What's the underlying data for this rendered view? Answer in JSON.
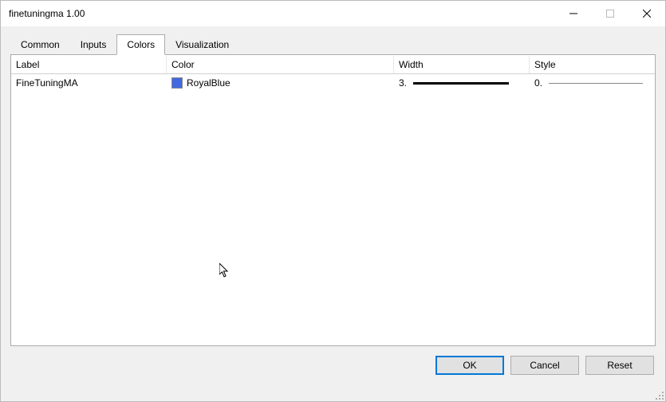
{
  "window": {
    "title": "finetuningma 1.00"
  },
  "tabs": {
    "items": [
      {
        "label": "Common"
      },
      {
        "label": "Inputs"
      },
      {
        "label": "Colors"
      },
      {
        "label": "Visualization"
      }
    ],
    "activeIndex": 2
  },
  "table": {
    "headers": {
      "label": "Label",
      "color": "Color",
      "width": "Width",
      "style": "Style"
    },
    "rows": [
      {
        "label": "FineTuningMA",
        "colorName": "RoyalBlue",
        "colorHex": "#4169E1",
        "widthValue": "3.",
        "styleValue": "0."
      }
    ]
  },
  "buttons": {
    "ok": "OK",
    "cancel": "Cancel",
    "reset": "Reset"
  }
}
